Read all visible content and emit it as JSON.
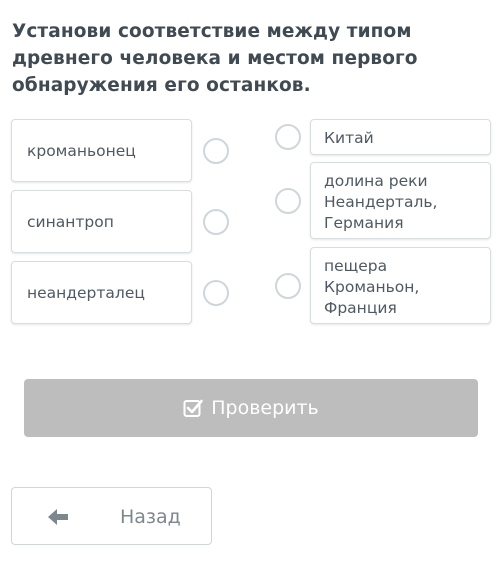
{
  "question": {
    "title": "Установи соответствие между типом древнего человека и местом первого обнаружения его останков."
  },
  "left_items": [
    {
      "label": "кроманьонец"
    },
    {
      "label": "синантроп"
    },
    {
      "label": "неандерталец"
    }
  ],
  "right_items": [
    {
      "label": "Китай"
    },
    {
      "label": "долина реки Неандерталь, Германия"
    },
    {
      "label": "пещера Кроманьон, Франция"
    }
  ],
  "check_button": {
    "label": "Проверить",
    "icon": "checkbox-check-icon",
    "color": "#bdbdbd"
  },
  "back_button": {
    "label": "Назад",
    "icon": "arrow-left-icon"
  }
}
